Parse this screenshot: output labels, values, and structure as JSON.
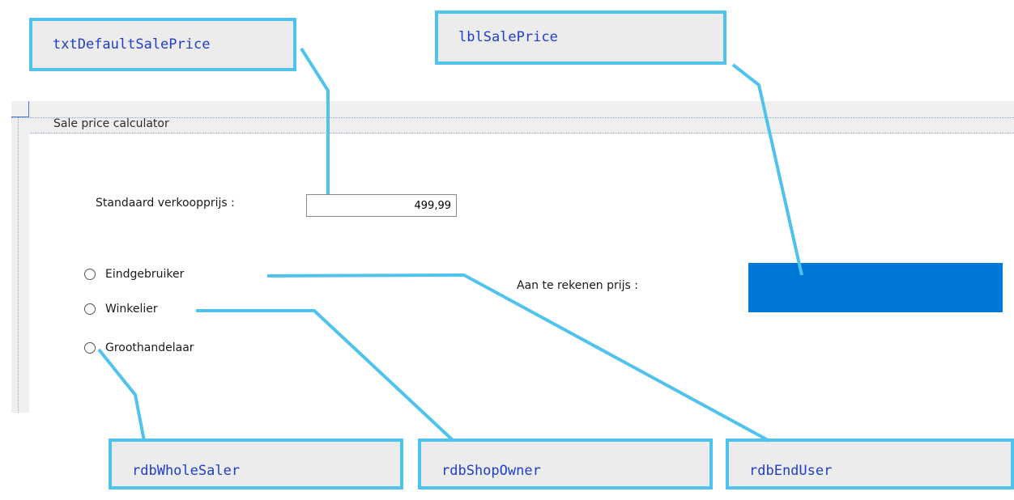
{
  "form": {
    "group_title": "Sale price calculator",
    "default_price_label": "Standaard verkoopprijs :",
    "default_price_value": "499,99",
    "charge_price_label": "Aan te rekenen prijs :",
    "sale_price_value": "",
    "radios": [
      {
        "label": "Eindgebruiker",
        "checked": false
      },
      {
        "label": "Winkelier",
        "checked": false
      },
      {
        "label": "Groothandelaar",
        "checked": false
      }
    ],
    "sale_price_color": "#0078d7"
  },
  "callouts": {
    "txt_default": "txtDefaultSalePrice",
    "lbl_sale": "lblSalePrice",
    "rdb_whole": "rdbWholeSaler",
    "rdb_shop": "rdbShopOwner",
    "rdb_end": "rdbEndUser",
    "accent_color": "#4fc3ec",
    "text_color": "#1f3ec6"
  }
}
